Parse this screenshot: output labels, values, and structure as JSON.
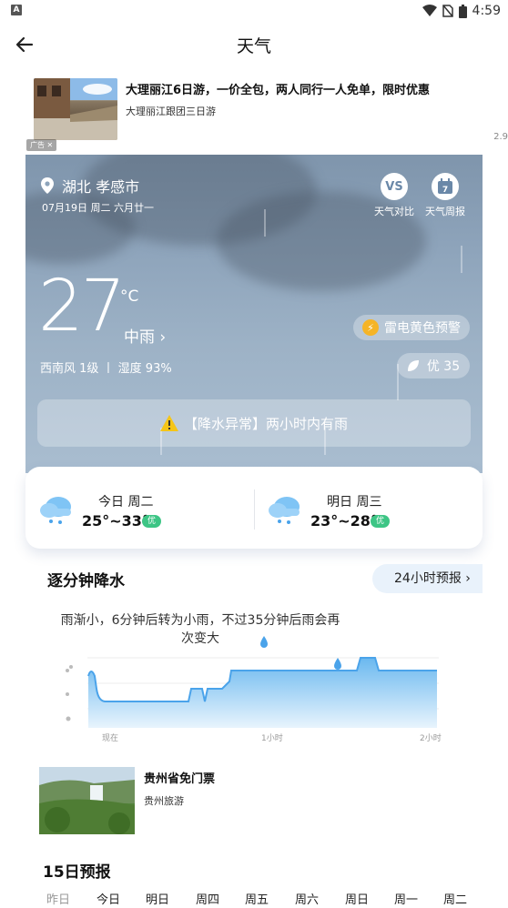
{
  "status_bar": {
    "time": "4:59",
    "left_icon": "A"
  },
  "header": {
    "title": "天气"
  },
  "ad_top": {
    "title": "大理丽江6日游，一价全包，两人同行一人免单，限时优惠",
    "subtitle": "大理丽江跟团三日游",
    "tag": "广告 ✕",
    "counter": "2.9"
  },
  "weather": {
    "location": "湖北 孝感市",
    "date": "07月19日 周二 六月廿一",
    "vs_label": "天气对比",
    "weekly_label": "天气周报",
    "weekly_icon_num": "7",
    "vs_icon": "VS",
    "temperature": "27",
    "unit": "°C",
    "condition": "中雨 ›",
    "warning": "雷电黄色预警",
    "wind": "西南风 1级 丨 湿度 93%",
    "aqi": "优 35",
    "alert": "【降水异常】两小时内有雨"
  },
  "days": [
    {
      "label": "今日 周二",
      "range": "25°~33°",
      "aqi": "优"
    },
    {
      "label": "明日 周三",
      "range": "23°~28°",
      "aqi": "优"
    }
  ],
  "minute_precip": {
    "title": "逐分钟降水",
    "button": "24小时预报 ›",
    "description": "雨渐小，6分钟后转为小雨，不过35分钟后雨会再次变大",
    "x_labels": [
      "现在",
      "1小时",
      "2小时"
    ]
  },
  "ad_bottom": {
    "title": "贵州省免门票",
    "subtitle": "贵州旅游"
  },
  "forecast": {
    "title": "15日预报",
    "days": [
      "昨日",
      "今日",
      "明日",
      "周四",
      "周五",
      "周六",
      "周日",
      "周一",
      "周二"
    ]
  },
  "colors": {
    "accent": "#5aa9e6",
    "aqi_green": "#3dc585",
    "warning_yellow": "#f5b427"
  }
}
